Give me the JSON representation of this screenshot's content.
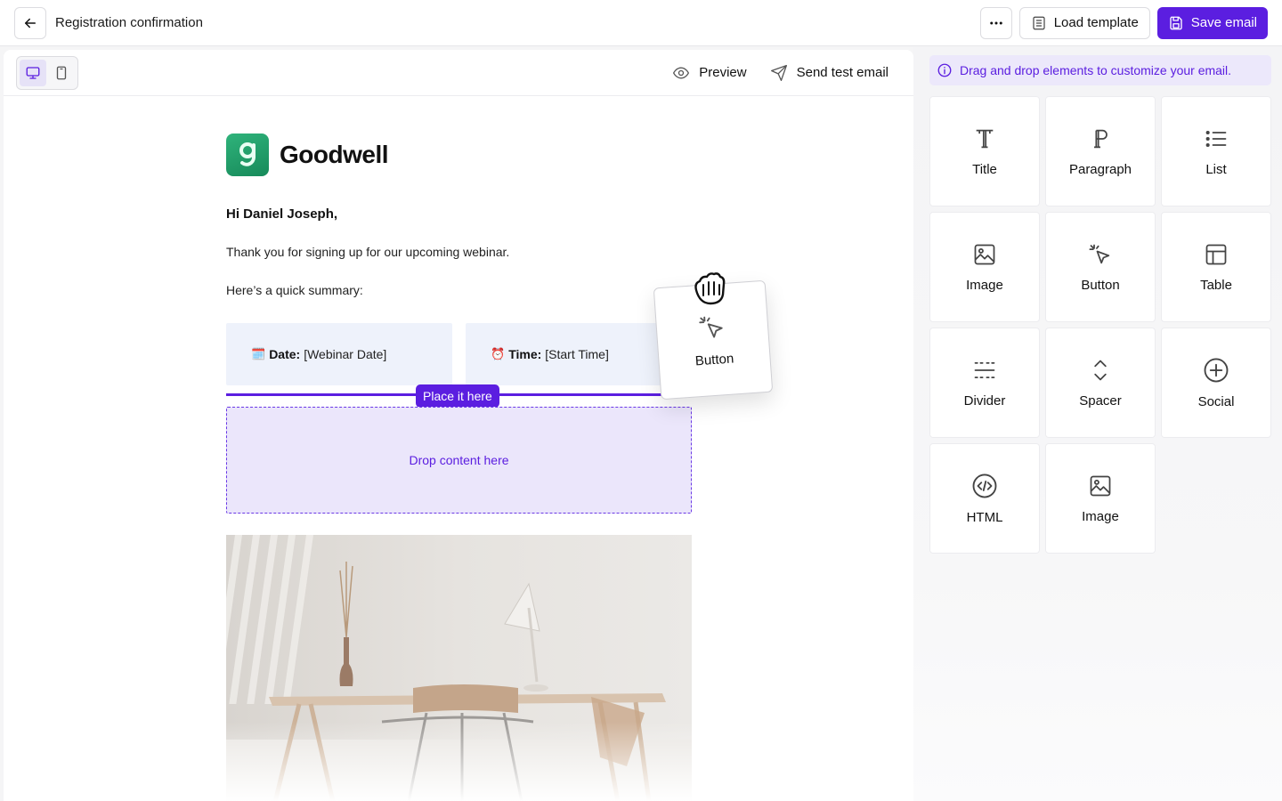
{
  "header": {
    "title": "Registration confirmation",
    "load_template": "Load template",
    "save_email": "Save email"
  },
  "canvas_toolbar": {
    "preview": "Preview",
    "send_test": "Send test email"
  },
  "email": {
    "brand": "Goodwell",
    "greeting": "Hi Daniel Joseph,",
    "line1": "Thank you for signing up for our upcoming webinar.",
    "line2": "Here’s a quick summary:",
    "date_label": "Date:",
    "date_value": "[Webinar Date]",
    "time_label": "Time:",
    "time_value": "[Start Time]",
    "place_badge": "Place it here",
    "drop_text": "Drop content here"
  },
  "drag_ghost": {
    "label": "Button"
  },
  "sidebar": {
    "hint": "Drag and drop elements to customize your email.",
    "elements": [
      {
        "label": "Title",
        "icon": "title-icon"
      },
      {
        "label": "Paragraph",
        "icon": "paragraph-icon"
      },
      {
        "label": "List",
        "icon": "list-icon"
      },
      {
        "label": "Image",
        "icon": "image-icon"
      },
      {
        "label": "Button",
        "icon": "cursor-click-icon"
      },
      {
        "label": "Table",
        "icon": "table-icon"
      },
      {
        "label": "Divider",
        "icon": "divider-icon"
      },
      {
        "label": "Spacer",
        "icon": "spacer-icon"
      },
      {
        "label": "Social",
        "icon": "plus-circle-icon"
      },
      {
        "label": "HTML",
        "icon": "code-icon"
      },
      {
        "label": "Image",
        "icon": "image-icon"
      }
    ]
  },
  "colors": {
    "accent": "#5b1ee0",
    "drop_zone_bg": "#ebe6fb",
    "summary_card_bg": "#eef2fb",
    "brand_green": "#1f9d68"
  }
}
